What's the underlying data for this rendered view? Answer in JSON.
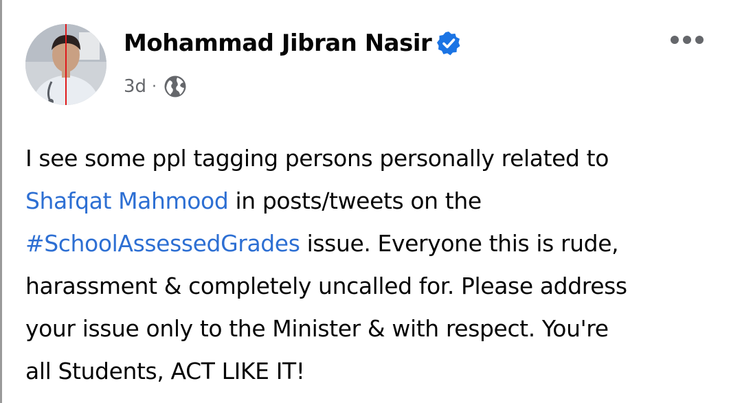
{
  "post": {
    "author_name": "Mohammad Jibran Nasir",
    "timestamp": "3d",
    "separator": "·",
    "verified_icon": "verified-badge-icon",
    "audience_icon": "globe-icon",
    "more_icon": "more-options-icon",
    "body": {
      "line1": "I see some ppl tagging persons personally related to",
      "line2_mention": "Shafqat Mahmood",
      "line2_rest": " in posts/tweets on the",
      "line3_hashtag": "#SchoolAssessedGrades",
      "line3_rest": " issue. Everyone this is rude,",
      "line4": "harassment & completely uncalled for. Please address",
      "line5": "your issue only to the Minister & with respect. You're",
      "line6": "all Students, ACT LIKE IT!"
    }
  },
  "colors": {
    "link": "#2d6fd3",
    "verified": "#1b74e4",
    "meta": "#65676b",
    "text": "#050505"
  }
}
